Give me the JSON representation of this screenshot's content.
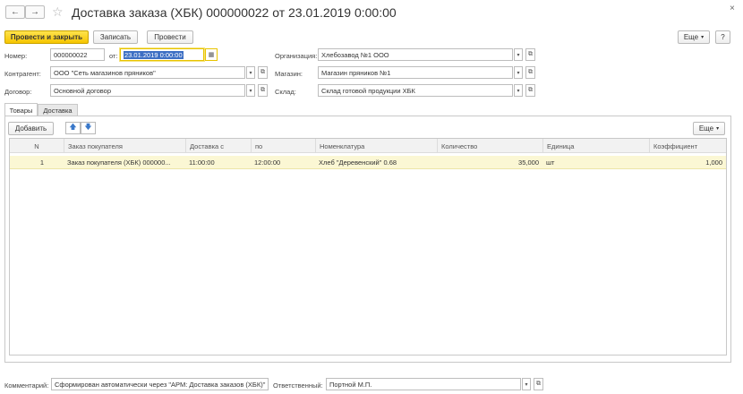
{
  "header": {
    "title": "Доставка заказа (ХБК) 000000022 от 23.01.2019 0:00:00",
    "back_icon": "←",
    "forward_icon": "→",
    "close_icon": "×"
  },
  "toolbar": {
    "post_close": "Провести и закрыть",
    "save": "Записать",
    "post": "Провести",
    "more": "Еще",
    "help": "?"
  },
  "form": {
    "number_label": "Номер:",
    "number_value": "000000022",
    "from_label": "от:",
    "date_value": "23.01.2019  0:00:00",
    "org_label": "Организация:",
    "org_value": "Хлебозавод №1 ООО",
    "contractor_label": "Контрагент:",
    "contractor_value": "ООО \"Сеть магазинов пряников\"",
    "store_label": "Магазин:",
    "store_value": "Магазин пряников №1",
    "contract_label": "Договор:",
    "contract_value": "Основной договор",
    "warehouse_label": "Склад:",
    "warehouse_value": "Склад готовой продукции ХБК"
  },
  "tabs": [
    {
      "label": "Товары",
      "active": true
    },
    {
      "label": "Доставка",
      "active": false
    }
  ],
  "grid_toolbar": {
    "add": "Добавить",
    "more": "Еще"
  },
  "grid": {
    "columns": [
      "N",
      "Заказ покупателя",
      "Доставка с",
      "по",
      "Номенклатура",
      "Количество",
      "Единица",
      "Коэффициент"
    ],
    "rows": [
      {
        "n": "1",
        "order": "Заказ покупателя (ХБК) 000000...",
        "from": "11:00:00",
        "to": "12:00:00",
        "item": "Хлеб \"Деревенский\" 0.68",
        "qty": "35,000",
        "unit": "шт",
        "coef": "1,000"
      }
    ]
  },
  "footer": {
    "comment_label": "Комментарий:",
    "comment_value": "Сформирован автоматически через \"АРМ: Доставка заказов (ХБК)\"",
    "responsible_label": "Ответственный:",
    "responsible_value": "Портной М.П."
  },
  "colors": {
    "primary_button": "#f6c500",
    "row_highlight": "#fbf7d4",
    "selection": "#3d6fc4"
  }
}
